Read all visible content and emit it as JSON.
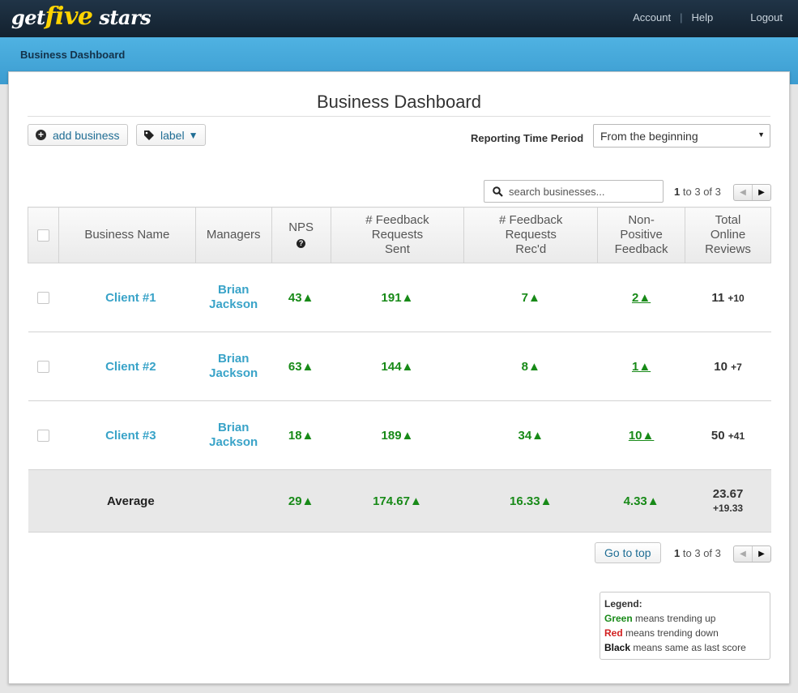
{
  "header": {
    "logo": {
      "get": "get",
      "five": "five",
      "stars": "stars"
    },
    "links": {
      "account": "Account",
      "help": "Help",
      "logout": "Logout",
      "sep": "|"
    }
  },
  "breadcrumb": "Business Dashboard",
  "page_title": "Business Dashboard",
  "toolbar": {
    "add_business": "add business",
    "label": "label",
    "label_caret": "▼"
  },
  "reporting": {
    "label": "Reporting Time Period",
    "value": "From the beginning",
    "arrow": "▼"
  },
  "search": {
    "placeholder": "search businesses..."
  },
  "pagination": {
    "start": "1",
    "to": "to",
    "end": "3",
    "of": "of",
    "total": "3"
  },
  "table": {
    "headers": {
      "name": "Business Name",
      "managers": "Managers",
      "nps": "NPS",
      "sent_1": "# Feedback",
      "sent_2": "Requests",
      "sent_3": "Sent",
      "recd_1": "# Feedback",
      "recd_2": "Requests",
      "recd_3": "Rec'd",
      "neg_1": "Non-",
      "neg_2": "Positive",
      "neg_3": "Feedback",
      "rev_1": "Total",
      "rev_2": "Online",
      "rev_3": "Reviews"
    },
    "rows": [
      {
        "name": "Client #1",
        "mgr_first": "Brian",
        "mgr_last": "Jackson",
        "nps": "43▲",
        "sent": "191▲",
        "recd": "7▲",
        "neg": "2▲",
        "reviews": "11",
        "reviews_delta": "+10"
      },
      {
        "name": "Client #2",
        "mgr_first": "Brian",
        "mgr_last": "Jackson",
        "nps": "63▲",
        "sent": "144▲",
        "recd": "8▲",
        "neg": "1▲",
        "reviews": "10",
        "reviews_delta": "+7"
      },
      {
        "name": "Client #3",
        "mgr_first": "Brian",
        "mgr_last": "Jackson",
        "nps": "18▲",
        "sent": "189▲",
        "recd": "34▲",
        "neg": "10▲",
        "reviews": "50",
        "reviews_delta": "+41"
      }
    ],
    "average": {
      "label": "Average",
      "nps": "29▲",
      "sent": "174.67▲",
      "recd": "16.33▲",
      "neg": "4.33▲",
      "reviews": "23.67",
      "reviews_delta": "+19.33"
    }
  },
  "go_to_top": "Go to top",
  "legend": {
    "title": "Legend:",
    "green_word": "Green",
    "green_text": "means trending up",
    "red_word": "Red",
    "red_text": "means trending down",
    "black_word": "Black",
    "black_text": "means same as last score"
  },
  "colors": {
    "trend_up": "#188a18",
    "trend_down": "#d21f1f",
    "link": "#39a3c8",
    "brand_bar": "#3c9cd0"
  }
}
